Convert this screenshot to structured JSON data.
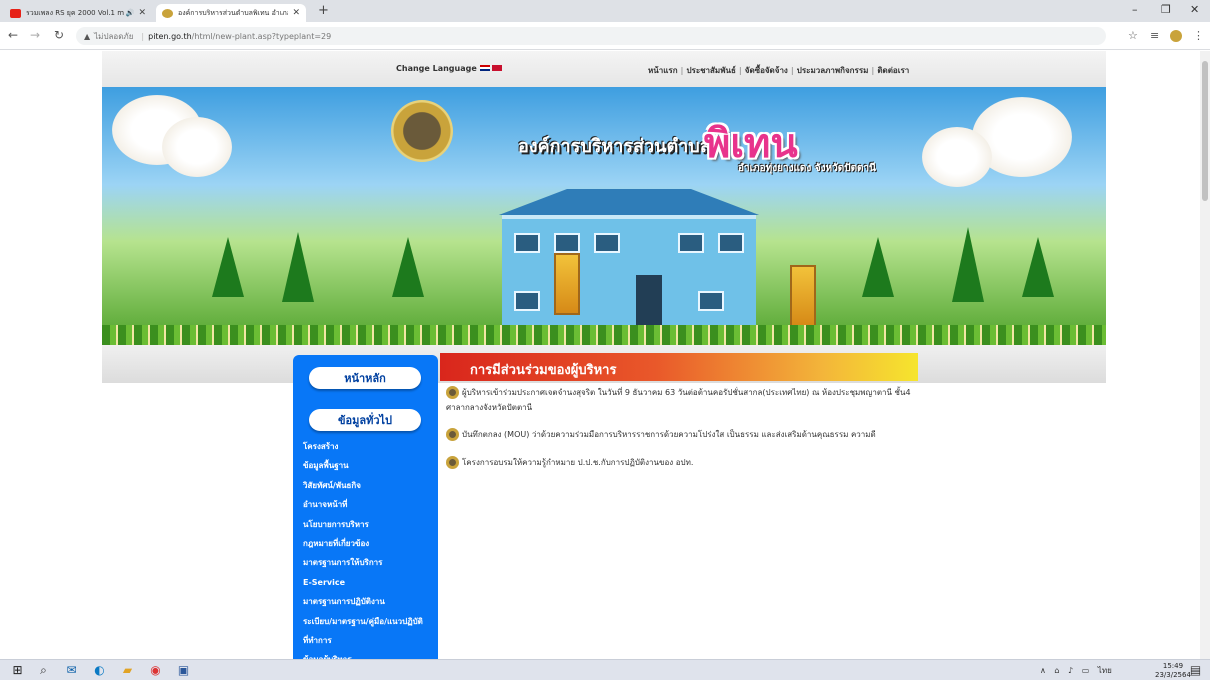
{
  "browser": {
    "tabs": [
      {
        "title": "รวมเพลง RS ยุค 2000 Vol.1 mu",
        "favicon": "youtube-icon",
        "color": "#e62117"
      },
      {
        "title": "องค์การบริหารส่วนตำบลพิเทน อำเภอ",
        "favicon": "site-logo-icon",
        "color": "#c9a33b"
      }
    ],
    "url_security": "ไม่ปลอดภัย",
    "url_host": "piten.go.th",
    "url_path": "/html/new-plant.asp?typeplant=29"
  },
  "site": {
    "change_language": "Change Language",
    "top_nav": [
      "หน้าแรก",
      "ประชาสัมพันธ์",
      "จัดซื้อจัดจ้าง",
      "ประมวลภาพกิจกรรม",
      "ติดต่อเรา"
    ],
    "org_title": "องค์การบริหารส่วนตำบล",
    "org_name": "พิเทน",
    "org_sub": "อำเภอทุ่งยางแดง จังหวัดปัตตานี",
    "logo_text": "อบต.พิเทน",
    "home_button": "หน้าหลัก",
    "general_button": "ข้อมูลทั่วไป",
    "sidebar_items": [
      "โครงสร้าง",
      "ข้อมูลพื้นฐาน",
      "วิสัยทัศน์/พันธกิจ",
      "อำนาจหน้าที่",
      "นโยบายการบริหาร",
      "กฎหมายที่เกี่ยวข้อง",
      "มาตรฐานการให้บริการ",
      "E-Service",
      "มาตรฐานการปฏิบัติงาน",
      "ระเบียบ/มาตรฐาน/คู่มือ/แนวปฏิบัติ",
      "ที่ทำการ",
      "ข้อมูลผู้บริหาร"
    ],
    "section_title": "การมีส่วนร่วมของผู้บริหาร",
    "news": [
      "ผู้บริหารเข้าร่วมประกาศเจตจำนงสุจริต ในวันที่ 9 ธันวาคม 63 วันต่อต้านคอรัปชั่นสากล(ประเทศไทย) ณ ห้องประชุมพญาตานี ชั้น4 ศาลากลางจังหวัดปัตตานี",
      "บันทึกตกลง (MOU) ว่าด้วยความร่วมมือการบริหารราชการด้วยความโปร่งใส เป็นธรรม และส่งเสริมด้านคุณธรรม ความดี",
      "โครงการอบรมให้ความรู้กำหมาย ป.ป.ช.กับการปฏิบัติงานของ อปท."
    ]
  },
  "taskbar": {
    "tray_lang": "ไทย",
    "time": "15:49",
    "date": "23/3/2564"
  }
}
